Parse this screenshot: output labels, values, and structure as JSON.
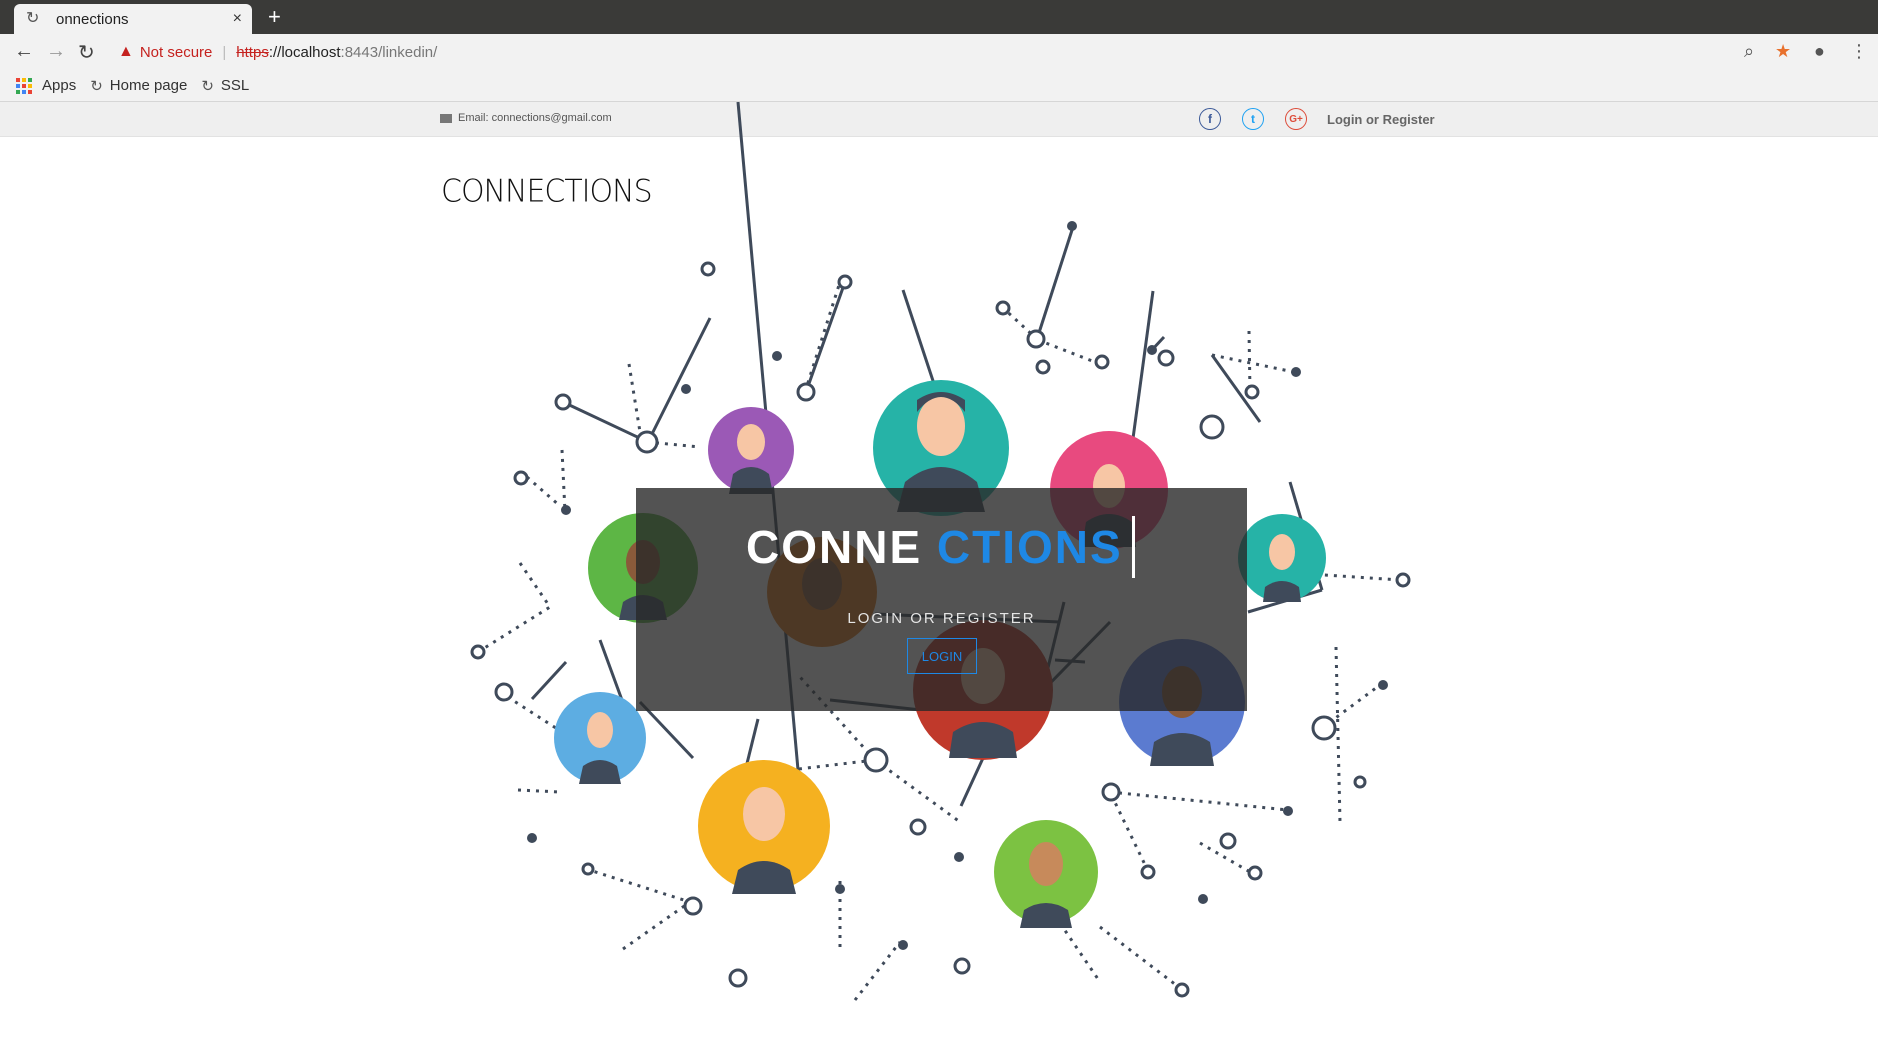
{
  "browser": {
    "tab_title": "onnections",
    "tab_close": "×",
    "new_tab": "+",
    "security_warning": "Not secure",
    "url_scheme": "https",
    "url_host": "://localhost",
    "url_rest": ":8443/linkedin/",
    "bookmarks": [
      "Apps",
      "Home page",
      "SSL"
    ]
  },
  "site": {
    "email_text": "Email: connections@gmail.com",
    "social": {
      "facebook": "f",
      "twitter": "t",
      "google": "G+"
    },
    "login_register_link": "Login or Register",
    "logo_text": "CONNECTIONS"
  },
  "hero": {
    "title_part1": "CONNE",
    "title_part2": "CTIONS",
    "subtitle": "LOGIN OR REGISTER",
    "button_label": "LOGIN"
  },
  "colors": {
    "accent_blue": "#1e88e5",
    "warning_red": "#c5221f",
    "facebook": "#3b5998",
    "twitter": "#1da1f2",
    "google": "#dd4b39"
  }
}
